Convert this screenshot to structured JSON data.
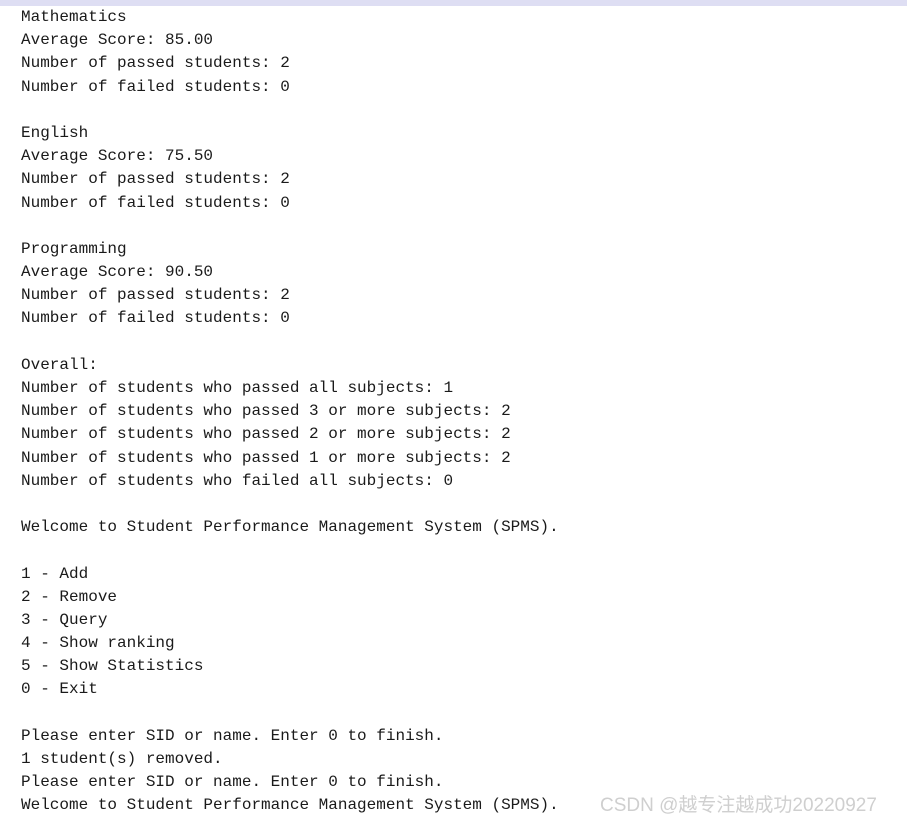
{
  "window": {
    "top_band_color": "#dedef3",
    "background_color": "#ffffff",
    "text_color": "#1a1a1a"
  },
  "console": {
    "lines": [
      "Mathematics",
      "Average Score: 85.00",
      "Number of passed students: 2",
      "Number of failed students: 0",
      "",
      "English",
      "Average Score: 75.50",
      "Number of passed students: 2",
      "Number of failed students: 0",
      "",
      "Programming",
      "Average Score: 90.50",
      "Number of passed students: 2",
      "Number of failed students: 0",
      "",
      "Overall:",
      "Number of students who passed all subjects: 1",
      "Number of students who passed 3 or more subjects: 2",
      "Number of students who passed 2 or more subjects: 2",
      "Number of students who passed 1 or more subjects: 2",
      "Number of students who failed all subjects: 0",
      "",
      "Welcome to Student Performance Management System (SPMS).",
      "",
      "1 - Add",
      "2 - Remove",
      "3 - Query",
      "4 - Show ranking",
      "5 - Show Statistics",
      "0 - Exit",
      "",
      "Please enter SID or name. Enter 0 to finish.",
      "1 student(s) removed.",
      "Please enter SID or name. Enter 0 to finish.",
      "Welcome to Student Performance Management System (SPMS)."
    ],
    "statistics": {
      "subjects": [
        {
          "name": "Mathematics",
          "average_score": "85.00",
          "passed_students": "2",
          "failed_students": "0"
        },
        {
          "name": "English",
          "average_score": "75.50",
          "passed_students": "2",
          "failed_students": "0"
        },
        {
          "name": "Programming",
          "average_score": "90.50",
          "passed_students": "2",
          "failed_students": "0"
        }
      ],
      "overall_label": "Overall:",
      "overall": [
        {
          "label": "Number of students who passed all subjects:",
          "value": "1"
        },
        {
          "label": "Number of students who passed 3 or more subjects:",
          "value": "2"
        },
        {
          "label": "Number of students who passed 2 or more subjects:",
          "value": "2"
        },
        {
          "label": "Number of students who passed 1 or more subjects:",
          "value": "2"
        },
        {
          "label": "Number of students who failed all subjects:",
          "value": "0"
        }
      ],
      "labels": {
        "average_score": "Average Score:",
        "passed_students": "Number of passed students:",
        "failed_students": "Number of failed students:"
      }
    },
    "welcome_message": "Welcome to Student Performance Management System (SPMS).",
    "menu": [
      {
        "key": "1",
        "label": "Add",
        "text": "1 - Add"
      },
      {
        "key": "2",
        "label": "Remove",
        "text": "2 - Remove"
      },
      {
        "key": "3",
        "label": "Query",
        "text": "3 - Query"
      },
      {
        "key": "4",
        "label": "Show ranking",
        "text": "4 - Show ranking"
      },
      {
        "key": "5",
        "label": "Show Statistics",
        "text": "5 - Show Statistics"
      },
      {
        "key": "0",
        "label": "Exit",
        "text": "0 - Exit"
      }
    ],
    "prompts": {
      "enter_sid_or_name": "Please enter SID or name. Enter 0 to finish.",
      "removed_confirmation": "1 student(s) removed."
    }
  },
  "watermark": {
    "text": "CSDN @越专注越成功20220927",
    "color": "#cfcfcf"
  }
}
